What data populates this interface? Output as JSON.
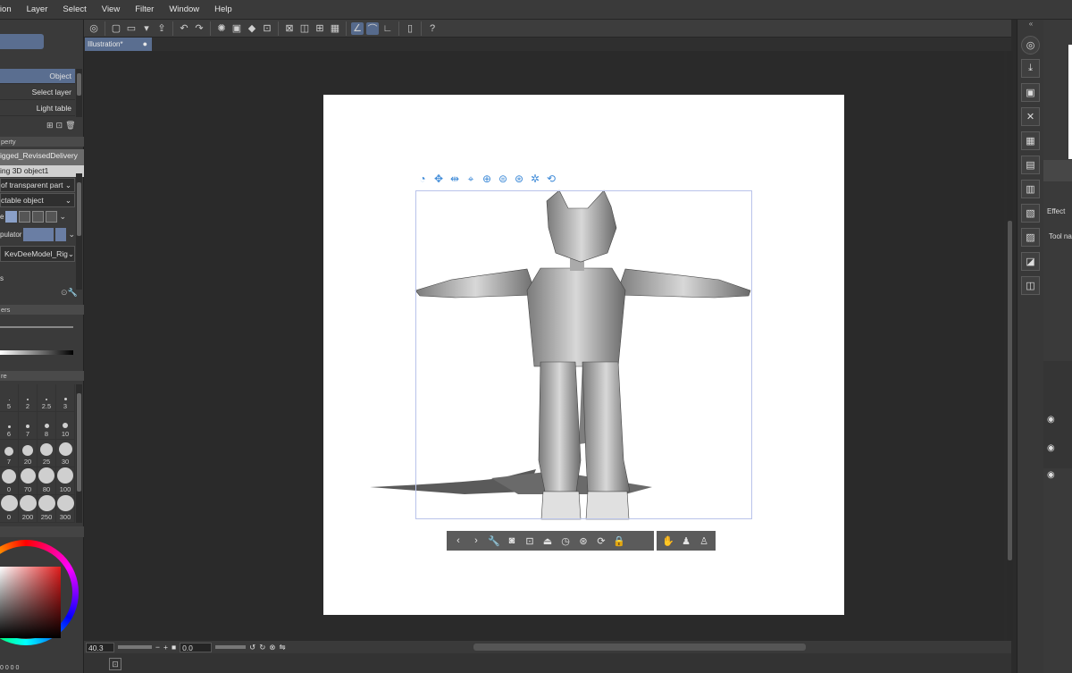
{
  "menubar": {
    "items": [
      "ation",
      "Layer",
      "Select",
      "View",
      "Filter",
      "Window",
      "Help"
    ]
  },
  "document": {
    "tab_title": "Illustration*",
    "tab_dot": "●"
  },
  "left_panel": {
    "rows": [
      "Object",
      "Select layer",
      "Light table"
    ],
    "property_header": "perty",
    "asset_name": "igged_RevisedDelivery",
    "object_name": "ing 3D object1",
    "transparent_select": "of transparent part",
    "table_object_select": "ctable object",
    "manipulator_label": "pulator",
    "model_select": "KevDeeModel_Rig",
    "small_label_s": "s",
    "headers_ers": "ers",
    "headers_re": "re"
  },
  "brush_sizes": [
    "5",
    "2",
    "2.5",
    "3",
    "6",
    "7",
    "8",
    "10",
    "7",
    "20",
    "25",
    "30",
    "0",
    "70",
    "80",
    "100",
    "0",
    "200",
    "250",
    "300"
  ],
  "statusbar": {
    "zoom": "40.3",
    "angle": "0.0"
  },
  "right_panel": {
    "effect": "Effect",
    "tool_name": "Tool na"
  },
  "colors": {
    "accent": "#566a8c",
    "launcher_blue": "#3f8bd8",
    "selection_box": "#b9c3ea"
  },
  "icons": {
    "cmdbar": [
      "clip-logo-icon",
      "new-icon",
      "open-icon",
      "save-icon",
      "share-icon",
      "undo-icon",
      "redo-icon",
      "loading-icon",
      "clear-icon",
      "fill-icon",
      "transform-icon",
      "deselect-icon",
      "invert-icon",
      "crop-icon",
      "ruler-icon",
      "snap-ruler-icon",
      "snap-special-icon",
      "snap-grid-icon",
      "device-icon",
      "help-icon"
    ],
    "object_launcher": [
      "camera-rotate-icon",
      "pan-icon",
      "move-icon",
      "move-xyz-icon",
      "rotate-icon",
      "rotate-2-icon",
      "rotate-3-icon",
      "reset-icon",
      "link-icon"
    ],
    "bottom_launcher": [
      "prev-icon",
      "next-icon",
      "settings-icon",
      "camera-icon",
      "fit-icon",
      "ground-icon",
      "clock-icon",
      "pose-icon",
      "reset-pose-icon",
      "lock-icon",
      "hand-pose-icon",
      "figure-icon",
      "figure-settings-icon"
    ]
  }
}
